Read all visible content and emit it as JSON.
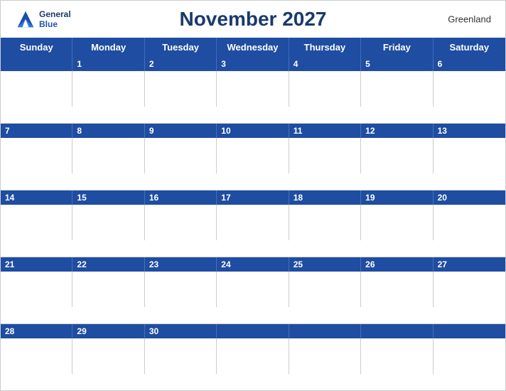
{
  "header": {
    "title": "November 2027",
    "region": "Greenland",
    "logo_line1": "General",
    "logo_line2": "Blue"
  },
  "days": [
    "Sunday",
    "Monday",
    "Tuesday",
    "Wednesday",
    "Thursday",
    "Friday",
    "Saturday"
  ],
  "weeks": [
    {
      "numbers": [
        "",
        "1",
        "2",
        "3",
        "4",
        "5",
        "6"
      ]
    },
    {
      "numbers": [
        "7",
        "8",
        "9",
        "10",
        "11",
        "12",
        "13"
      ]
    },
    {
      "numbers": [
        "14",
        "15",
        "16",
        "17",
        "18",
        "19",
        "20"
      ]
    },
    {
      "numbers": [
        "21",
        "22",
        "23",
        "24",
        "25",
        "26",
        "27"
      ]
    },
    {
      "numbers": [
        "28",
        "29",
        "30",
        "",
        "",
        "",
        ""
      ]
    }
  ]
}
